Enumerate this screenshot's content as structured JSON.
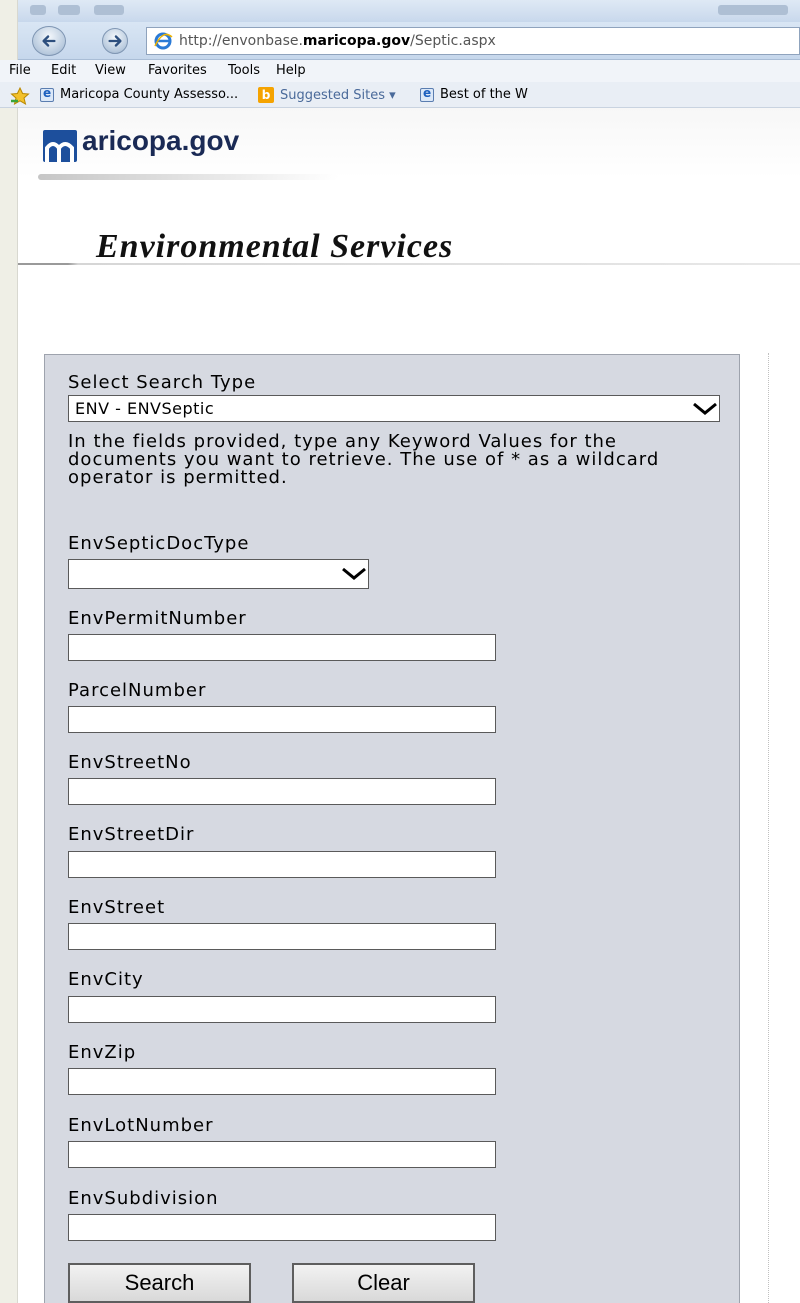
{
  "browser": {
    "url_prefix": "http://envonbase.",
    "url_domain": "maricopa.gov",
    "url_path": "/Septic.aspx",
    "menu": [
      "File",
      "Edit",
      "View",
      "Favorites",
      "Tools",
      "Help"
    ],
    "favorites": {
      "item1": "Maricopa County Assesso...",
      "item2": "Suggested Sites ▾",
      "item3": "Best of the W"
    },
    "icons": [
      "back-arrow-icon",
      "forward-arrow-icon",
      "ie-icon",
      "favorites-star-icon",
      "bing-icon"
    ]
  },
  "header": {
    "logo_text": "aricopa.gov",
    "section_title": "Environmental Services"
  },
  "form": {
    "search_type_label": "Select Search Type",
    "search_type_value": "ENV - ENVSeptic",
    "instructions": "In the fields provided, type any Keyword Values for the documents you want to retrieve. The use of * as a wildcard operator is permitted.",
    "doc_type_label": "EnvSepticDocType",
    "doc_type_value": "",
    "fields": {
      "permit": "EnvPermitNumber",
      "parcel": "ParcelNumber",
      "street_no": "EnvStreetNo",
      "street_dir": "EnvStreetDir",
      "street": "EnvStreet",
      "city": "EnvCity",
      "zip": "EnvZip",
      "lot": "EnvLotNumber",
      "subdivision": "EnvSubdivision"
    },
    "search_button": "Search",
    "clear_button": "Clear"
  }
}
